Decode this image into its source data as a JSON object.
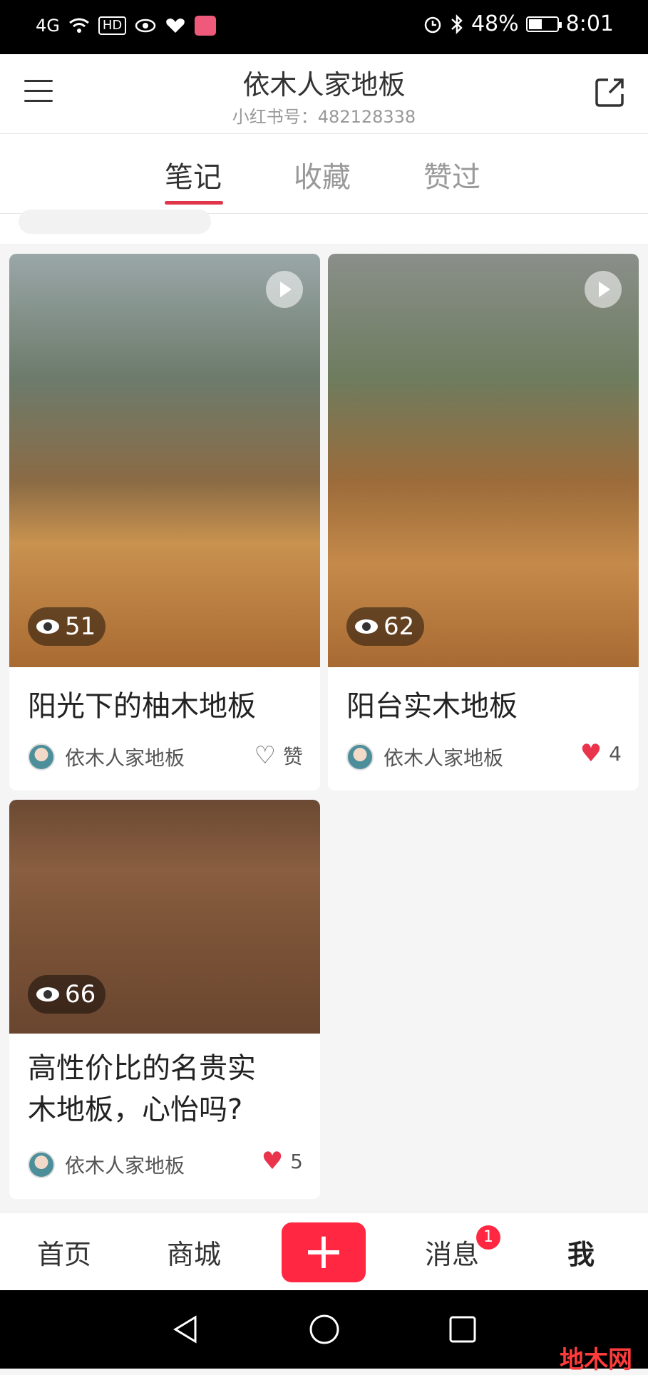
{
  "status_bar": {
    "network": "4G",
    "hd_label": "HD",
    "battery": "48%",
    "time": "8:01",
    "battery_level": 0.48
  },
  "header": {
    "title": "依木人家地板",
    "subtitle": "小红书号：482128338"
  },
  "tabs": [
    {
      "label": "笔记"
    },
    {
      "label": "收藏"
    },
    {
      "label": "赞过"
    }
  ],
  "cards": [
    {
      "title": "阳光下的柚木地板",
      "views": "51",
      "author": "依木人家地板",
      "likes": "赞",
      "liked": false,
      "video": true
    },
    {
      "title": "阳台实木地板",
      "views": "62",
      "author": "依木人家地板",
      "likes": "4",
      "liked": true,
      "video": true
    },
    {
      "title_line1": "高性价比的名贵实",
      "title_line2": "木地板，心怡吗?",
      "views": "66",
      "author": "依木人家地板",
      "likes": "5",
      "liked": true,
      "video": false
    }
  ],
  "bottom_nav": {
    "home": "首页",
    "mall": "商城",
    "add": "+",
    "messages": "消息",
    "message_badge": "1",
    "me": "我"
  },
  "watermark": "地木网",
  "colors": {
    "accent": "#e0364a",
    "add_button": "#ff2741",
    "heart": "#e9344c"
  }
}
